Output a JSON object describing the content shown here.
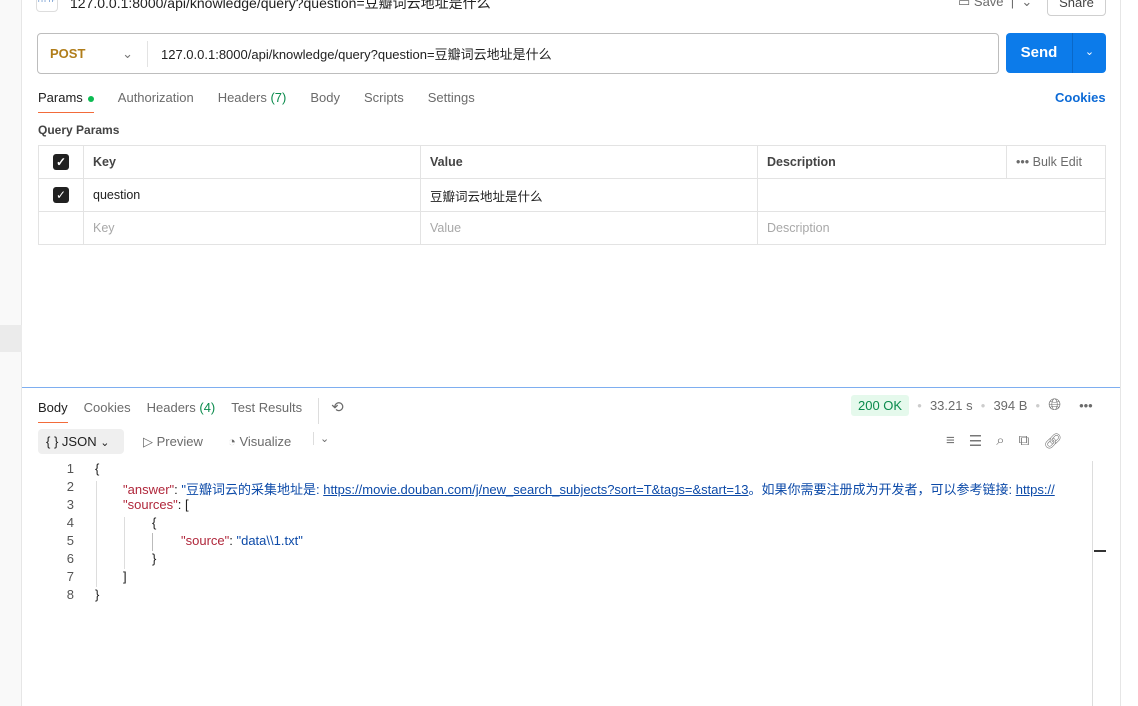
{
  "header": {
    "title": "127.0.0.1:8000/api/knowledge/query?question=豆瓣词云地址是什么",
    "http_icon": "HTTP",
    "save": "Save",
    "share": "Share"
  },
  "request": {
    "method": "POST",
    "url": "127.0.0.1:8000/api/knowledge/query?question=豆瓣词云地址是什么",
    "send": "Send",
    "tabs": [
      "Params",
      "Authorization",
      "Headers",
      "(7)",
      "Body",
      "Scripts",
      "Settings"
    ],
    "cookies": "Cookies"
  },
  "params": {
    "title": "Query Params",
    "headers": [
      "Key",
      "Value",
      "Description"
    ],
    "bulk_edit": "Bulk Edit",
    "rows": [
      {
        "key": "question",
        "value": "豆瓣词云地址是什么",
        "description": ""
      }
    ],
    "placeholders": {
      "key": "Key",
      "value": "Value",
      "description": "Description"
    }
  },
  "response": {
    "tabs": [
      "Body",
      "Cookies",
      "Headers",
      "(4)",
      "Test Results"
    ],
    "status": "200 OK",
    "time": "33.21 s",
    "size": "394 B",
    "format": "JSON",
    "preview": "Preview",
    "visualize": "Visualize",
    "code": {
      "l1": "{",
      "k_answer": "\"answer\"",
      "colon": ": ",
      "a_pre": "\"豆瓣词云的采集地址是: ",
      "a_url": "https://movie.douban.com/j/new_search_subjects?sort=T&tags=&start=13",
      "a_mid": "。如果你需要注册成为开发者，可以参考链接: ",
      "a_url2": "https://",
      "k_sources": "\"sources\"",
      "open_bracket": "[",
      "open_brace": "{",
      "k_source": "\"source\"",
      "v_source": "\"data\\\\1.txt\"",
      "close_brace": "}",
      "close_bracket": "]",
      "l8": "}"
    }
  }
}
